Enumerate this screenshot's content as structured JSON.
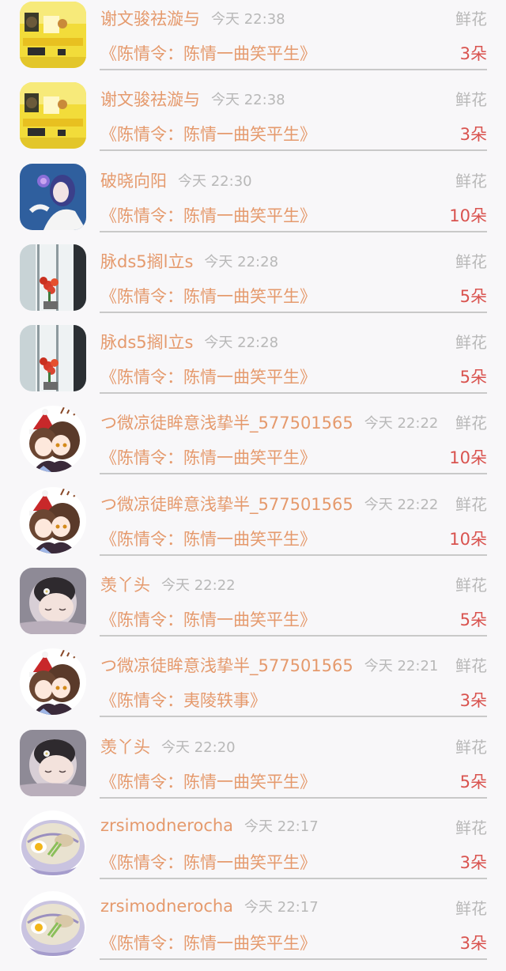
{
  "gift_list": [
    {
      "username": "谢文骏祛漩与",
      "time": "今天 22:38",
      "gift_type": "鲜花",
      "book": "《陈情令：陈情一曲笑平生》",
      "count": "3朵",
      "avatar": "yellow-room"
    },
    {
      "username": "谢文骏祛漩与",
      "time": "今天 22:38",
      "gift_type": "鲜花",
      "book": "《陈情令：陈情一曲笑平生》",
      "count": "3朵",
      "avatar": "yellow-room"
    },
    {
      "username": "破晓向阳",
      "time": "今天 22:30",
      "gift_type": "鲜花",
      "book": "《陈情令：陈情一曲笑平生》",
      "count": "10朵",
      "avatar": "blue-girl"
    },
    {
      "username": "脉ds5搁l立s",
      "time": "今天 22:28",
      "gift_type": "鲜花",
      "book": "《陈情令：陈情一曲笑平生》",
      "count": "5朵",
      "avatar": "window-flowers"
    },
    {
      "username": "脉ds5搁l立s",
      "time": "今天 22:28",
      "gift_type": "鲜花",
      "book": "《陈情令：陈情一曲笑平生》",
      "count": "5朵",
      "avatar": "window-flowers"
    },
    {
      "username": "つ微凉徒眸意浅挚半_577501565",
      "time": "今天 22:22",
      "gift_type": "鲜花",
      "book": "《陈情令：陈情一曲笑平生》",
      "count": "10朵",
      "avatar": "anime-christmas"
    },
    {
      "username": "つ微凉徒眸意浅挚半_577501565",
      "time": "今天 22:22",
      "gift_type": "鲜花",
      "book": "《陈情令：陈情一曲笑平生》",
      "count": "10朵",
      "avatar": "anime-christmas"
    },
    {
      "username": "羡丫头",
      "time": "今天 22:22",
      "gift_type": "鲜花",
      "book": "《陈情令：陈情一曲笑平生》",
      "count": "5朵",
      "avatar": "sleeping-baby"
    },
    {
      "username": "つ微凉徒眸意浅挚半_577501565",
      "time": "今天 22:21",
      "gift_type": "鲜花",
      "book": "《陈情令：夷陵轶事》",
      "count": "3朵",
      "avatar": "anime-christmas"
    },
    {
      "username": "羡丫头",
      "time": "今天 22:20",
      "gift_type": "鲜花",
      "book": "《陈情令：陈情一曲笑平生》",
      "count": "5朵",
      "avatar": "sleeping-baby"
    },
    {
      "username": "zrsimodnerocha",
      "time": "今天 22:17",
      "gift_type": "鲜花",
      "book": "《陈情令：陈情一曲笑平生》",
      "count": "3朵",
      "avatar": "ramen-bowl"
    },
    {
      "username": "zrsimodnerocha",
      "time": "今天 22:17",
      "gift_type": "鲜花",
      "book": "《陈情令：陈情一曲笑平生》",
      "count": "3朵",
      "avatar": "ramen-bowl"
    }
  ],
  "colors": {
    "username": "#e59a6d",
    "book_title": "#e59a6d",
    "count": "#d9534f",
    "muted": "#b8b8b8",
    "divider": "#c9c9c9",
    "background": "#f8f7f9"
  }
}
